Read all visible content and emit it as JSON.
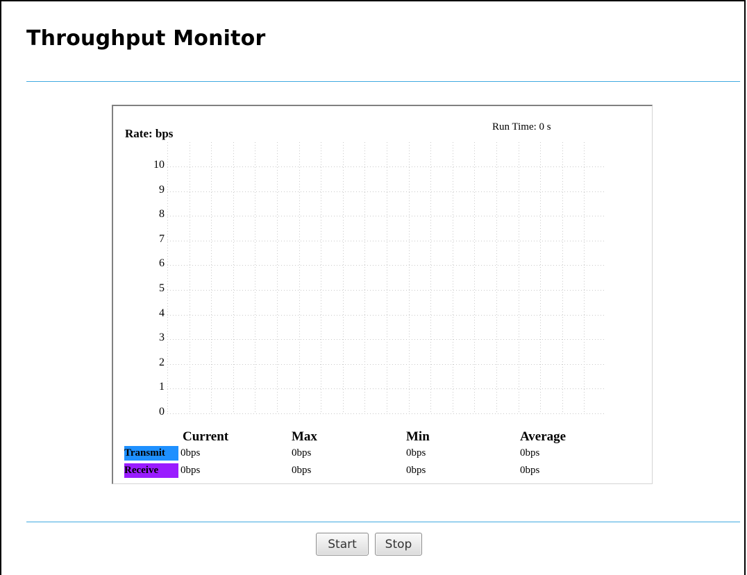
{
  "page": {
    "title": "Throughput Monitor"
  },
  "monitor": {
    "rate_label": "Rate: bps",
    "run_time_label": "Run Time:",
    "run_time_value": "0",
    "run_time_unit": "s",
    "grid_color": "#c8c8c8"
  },
  "chart_data": {
    "type": "line",
    "ylabel": "Rate: bps",
    "ylim": [
      0,
      10
    ],
    "y_ticks": [
      "0",
      "1",
      "2",
      "3",
      "4",
      "5",
      "6",
      "7",
      "8",
      "9",
      "10"
    ],
    "grid": true,
    "series": [
      {
        "name": "Transmit",
        "color": "#1e90ff",
        "values": []
      },
      {
        "name": "Receive",
        "color": "#9a1cff",
        "values": []
      }
    ]
  },
  "stats": {
    "headers": {
      "current": "Current",
      "max": "Max",
      "min": "Min",
      "average": "Average"
    },
    "rows": [
      {
        "label": "Transmit",
        "color": "#1e90ff",
        "current": "0bps",
        "max": "0bps",
        "min": "0bps",
        "average": "0bps"
      },
      {
        "label": "Receive",
        "color": "#9a1cff",
        "current": "0bps",
        "max": "0bps",
        "min": "0bps",
        "average": "0bps"
      }
    ]
  },
  "buttons": {
    "start": "Start",
    "stop": "Stop"
  }
}
